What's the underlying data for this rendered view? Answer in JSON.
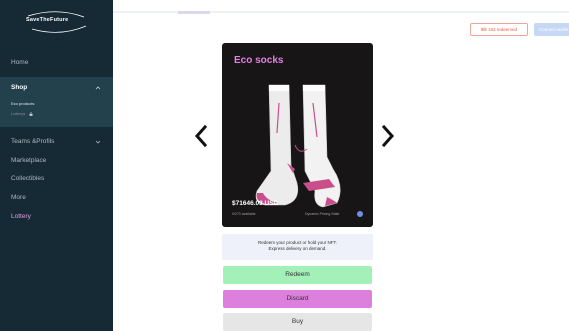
{
  "brand": {
    "logo_text": "SaveTheFuture"
  },
  "sidebar": {
    "home": "Home",
    "shop": {
      "label": "Shop",
      "sub_items": [
        "Eco products",
        "Lotterys"
      ]
    },
    "teams": "Teams &Profils",
    "marketplace": "Marketplace",
    "collectibles": "Collectibles",
    "more": "More",
    "lottery": "Lottery"
  },
  "header": {
    "tickets_label": "🎟 183 redeemed",
    "connect_label": "Connect wallet"
  },
  "product": {
    "title": "Eco socks",
    "price": "$71646.03 USD",
    "available": "0/270 available",
    "dynamic_pricing": "Dynamic Pricing State"
  },
  "redeem_info": {
    "line1": "Redeem your product or hold your NFT.",
    "line2": "Express delivery on demand."
  },
  "actions": {
    "redeem": "Redeem",
    "discard": "Discard",
    "buy": "Buy"
  },
  "colors": {
    "sidebar_bg": "#152a34",
    "accent_pink": "#e57fe5",
    "redeem_green": "#a4f0b9",
    "discard_pink": "#dd7fdd",
    "card_bg": "#171515"
  },
  "icons": [
    "chevron-left-icon",
    "chevron-right-icon",
    "chevron-up-icon",
    "chevron-down-icon",
    "lock-icon",
    "info-icon"
  ]
}
